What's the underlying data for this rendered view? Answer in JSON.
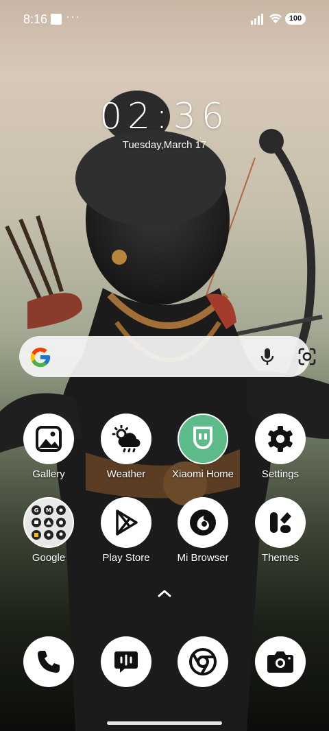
{
  "status_bar": {
    "time": "8:16",
    "more": "···",
    "battery": "100"
  },
  "clock": {
    "time": "02:36",
    "date": "Tuesday,March 17"
  },
  "search": {
    "icons": [
      "google-g-icon",
      "mic-icon",
      "lens-icon"
    ]
  },
  "apps_row1": [
    {
      "label": "Gallery",
      "icon": "gallery-icon"
    },
    {
      "label": "Weather",
      "icon": "weather-icon"
    },
    {
      "label": "Xiaomi Home",
      "icon": "xiaomi-home-icon"
    },
    {
      "label": "Settings",
      "icon": "gear-icon"
    }
  ],
  "apps_row2": [
    {
      "label": "Google",
      "icon": "google-folder-icon"
    },
    {
      "label": "Play Store",
      "icon": "play-store-icon"
    },
    {
      "label": "Mi Browser",
      "icon": "mi-browser-icon"
    },
    {
      "label": "Themes",
      "icon": "themes-icon"
    }
  ],
  "dock": [
    {
      "icon": "phone-icon"
    },
    {
      "icon": "messages-icon"
    },
    {
      "icon": "chrome-icon"
    },
    {
      "icon": "camera-icon"
    }
  ],
  "colors": {
    "xiaomi_home_bg": "#5dbb8a",
    "icon_bg": "#ffffff",
    "label": "#ffffff"
  }
}
